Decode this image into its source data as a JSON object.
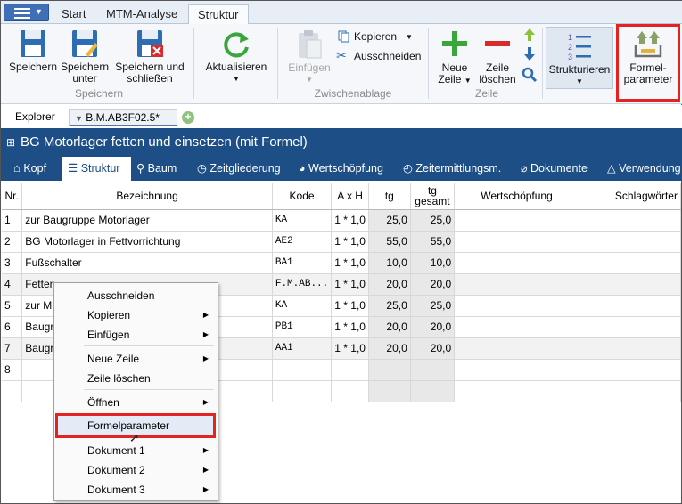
{
  "tabs": [
    "Start",
    "MTM-Analyse",
    "Struktur"
  ],
  "ribbon": {
    "speichern": "Speichern",
    "speichern_unter_1": "Speichern",
    "speichern_unter_2": "unter",
    "speichern_schliessen_1": "Speichern und",
    "speichern_schliessen_2": "schließen",
    "group_speichern": "Speichern",
    "aktualisieren": "Aktualisieren",
    "einfuegen": "Einfügen",
    "kopieren": "Kopieren",
    "ausschneiden": "Ausschneiden",
    "group_zwischenablage": "Zwischenablage",
    "neue_zeile_1": "Neue",
    "neue_zeile_2": "Zeile",
    "zeile_loeschen_1": "Zeile",
    "zeile_loeschen_2": "löschen",
    "group_zeile": "Zeile",
    "strukturieren": "Strukturieren",
    "formel_1": "Formel-",
    "formel_2": "parameter"
  },
  "doctabs": {
    "explorer": "Explorer",
    "active": "B.M.AB3F02.5*"
  },
  "title": "BG Motorlager fetten und einsetzen (mit Formel)",
  "nav": [
    "Kopf",
    "Struktur",
    "Baum",
    "Zeitgliederung",
    "Wertschöpfung",
    "Zeitermittlungsm.",
    "Dokumente",
    "Verwendung"
  ],
  "grid": {
    "headers": [
      "Nr.",
      "Bezeichnung",
      "Kode",
      "A x H",
      "tg",
      "tg",
      "gesamt",
      "Wertschöpfung",
      "Schlagwörter"
    ],
    "rows": [
      {
        "nr": "1",
        "bez": "zur Baugruppe Motorlager",
        "kode": "KA",
        "axh": "1 * 1,0",
        "tg": "25,0",
        "tgg": "25,0"
      },
      {
        "nr": "2",
        "bez": "BG Motorlager in Fettvorrichtung",
        "kode": "AE2",
        "axh": "1 * 1,0",
        "tg": "55,0",
        "tgg": "55,0"
      },
      {
        "nr": "3",
        "bez": "Fußschalter",
        "kode": "BA1",
        "axh": "1 * 1,0",
        "tg": "10,0",
        "tgg": "10,0"
      },
      {
        "nr": "4",
        "bez": "Fetten",
        "kode": "F.M.AB...",
        "axh": "1 * 1,0",
        "tg": "20,0",
        "tgg": "20,0"
      },
      {
        "nr": "5",
        "bez": "zur M",
        "kode": "KA",
        "axh": "1 * 1,0",
        "tg": "25,0",
        "tgg": "25,0"
      },
      {
        "nr": "6",
        "bez": "Baugr",
        "kode": "PB1",
        "axh": "1 * 1,0",
        "tg": "20,0",
        "tgg": "20,0"
      },
      {
        "nr": "7",
        "bez": "Baugr",
        "kode": "AA1",
        "axh": "1 * 1,0",
        "tg": "20,0",
        "tgg": "20,0"
      },
      {
        "nr": "8",
        "bez": "",
        "kode": "",
        "axh": "",
        "tg": "",
        "tgg": ""
      },
      {
        "nr": "",
        "bez": "",
        "kode": "",
        "axh": "",
        "tg": "",
        "tgg": ""
      }
    ]
  },
  "context_menu": {
    "ausschneiden": "Ausschneiden",
    "kopieren": "Kopieren",
    "einfuegen": "Einfügen",
    "neue_zeile": "Neue Zeile",
    "zeile_loeschen": "Zeile löschen",
    "oeffnen": "Öffnen",
    "formelparameter": "Formelparameter",
    "dokument1": "Dokument 1",
    "dokument2": "Dokument 2",
    "dokument3": "Dokument 3"
  },
  "colors": {
    "accent_blue": "#1d4f86",
    "highlight_red": "#e32222",
    "green": "#3aa63a",
    "red": "#d92b2b"
  }
}
